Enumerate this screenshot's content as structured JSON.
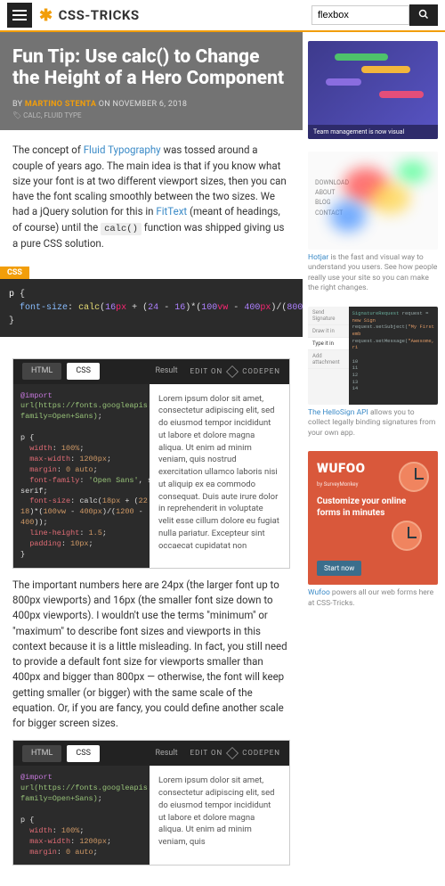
{
  "header": {
    "site_name": "CSS-TRICKS",
    "search_value": "flexbox"
  },
  "article": {
    "title": "Fun Tip: Use calc() to Change the Height of a Hero Component",
    "author": "MARTINO STENTA",
    "byline_prefix": "BY ",
    "byline_mid": " ON ",
    "date": "NOVEMBER 6, 2018",
    "tags": "CALC, FLUID TYPE",
    "intro_1": "The concept of ",
    "intro_link1": "Fluid Typography",
    "intro_2": " was tossed around a couple of years ago. The main idea is that if you know what size your font is at two different viewport sizes, then you can have the font scaling smoothly between the two sizes. We had a jQuery solution for this in ",
    "intro_link2": "FitText",
    "intro_3": " (meant of headings, of course) until the ",
    "intro_code": "calc()",
    "intro_4": " function was shipped giving us a pure CSS solution.",
    "code_label": "CSS",
    "para2": "The important numbers here are 24px (the larger font up to 800px viewports) and 16px (the smaller font size down to 400px viewports). I wouldn't use the terms \"minimum\" or \"maximum\" to describe font sizes and viewports in this context because it is a little misleading. In fact, you still need to provide a default font size for viewports smaller than 400px and bigger than 800px — otherwise, the font will keep getting smaller (or bigger) with the same scale of the equation. Or, if you are fancy, you could define another scale for bigger screen sizes."
  },
  "codepen": {
    "tab_html": "HTML",
    "tab_css": "CSS",
    "result_label": "Result",
    "edit_label": "EDIT ON",
    "brand": "CODEPEN",
    "lorem": "Lorem ipsum dolor sit amet, consectetur adipiscing elit, sed do eiusmod tempor incididunt ut labore et dolore magna aliqua. Ut enim ad minim veniam, quis nostrud exercitation ullamco laboris nisi ut aliquip ex ea commodo consequat. Duis aute irure dolor in reprehenderit in voluptate velit esse cillum dolore eu fugiat nulla pariatur. Excepteur sint occaecat cupidatat non",
    "lorem2": "Lorem ipsum dolor sit amet, consectetur adipiscing elit, sed do eiusmod tempor incididunt ut labore et dolore magna aliqua. Ut enim ad minim veniam, quis"
  },
  "sidebar": {
    "ad1_foot": "Team management is now visual",
    "ad2_link": "Hotjar",
    "ad2_text": " is the fast and visual way to understand you users. See how people really use your site so you can make the right changes.",
    "ad3_link": "The HelloSign API",
    "ad3_text": " allows you to collect legally binding signatures from your own app.",
    "ad4_logo": "WUFOO",
    "ad4_sub": "by SurveyMonkey",
    "ad4_copy": "Customize your online forms in minutes",
    "ad4_btn": "Start now",
    "ad4_link": "Wufoo",
    "ad4_caption": " powers all our web forms here at CSS-Tricks."
  }
}
